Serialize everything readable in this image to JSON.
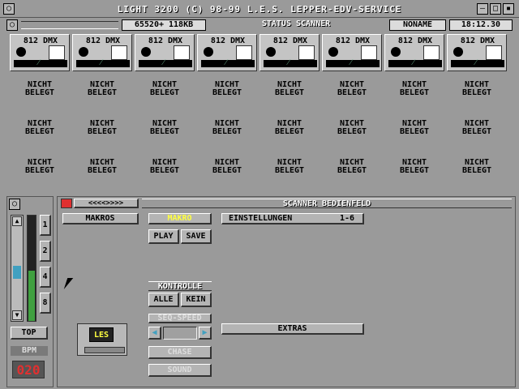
{
  "window": {
    "title": "LIGHT 3200 (C) 98-99 L.E.S. LEPPER-EDV-SERVICE"
  },
  "status": {
    "memory": "65520+ 118KB",
    "title": "STATUS SCANNER",
    "name": "NONAME",
    "time": "18:12.30"
  },
  "channels": {
    "label": "812 DMX",
    "count": 8
  },
  "grid": {
    "empty_label_1": "NICHT",
    "empty_label_2": "BELEGT"
  },
  "left_panel": {
    "numbers": [
      "1",
      "2",
      "4",
      "8"
    ],
    "top_label": "TOP",
    "bpm_label": "BPM",
    "bpm_value": "020"
  },
  "main_panel": {
    "title": "SCANNER BEDIENFELD",
    "nav_arrows": "<<<<>>>>",
    "makros": "MAKROS",
    "makro": "MAKRO",
    "einstellungen": "EINSTELLUNGEN",
    "einstellungen_range": "1-6",
    "play": "PLAY",
    "save": "SAVE",
    "kontrolle": "KONTROLLE",
    "alle": "ALLE",
    "kein": "KEIN",
    "seq_speed": "SEQ-SPEED",
    "chase": "CHASE",
    "sound": "SOUND",
    "extras": "EXTRAS",
    "logo": "LES"
  },
  "colors": {
    "accent_yellow": "#ffff40",
    "led_red": "#e03030",
    "slider_green": "#40a040",
    "slider_cyan": "#40a0c0"
  }
}
